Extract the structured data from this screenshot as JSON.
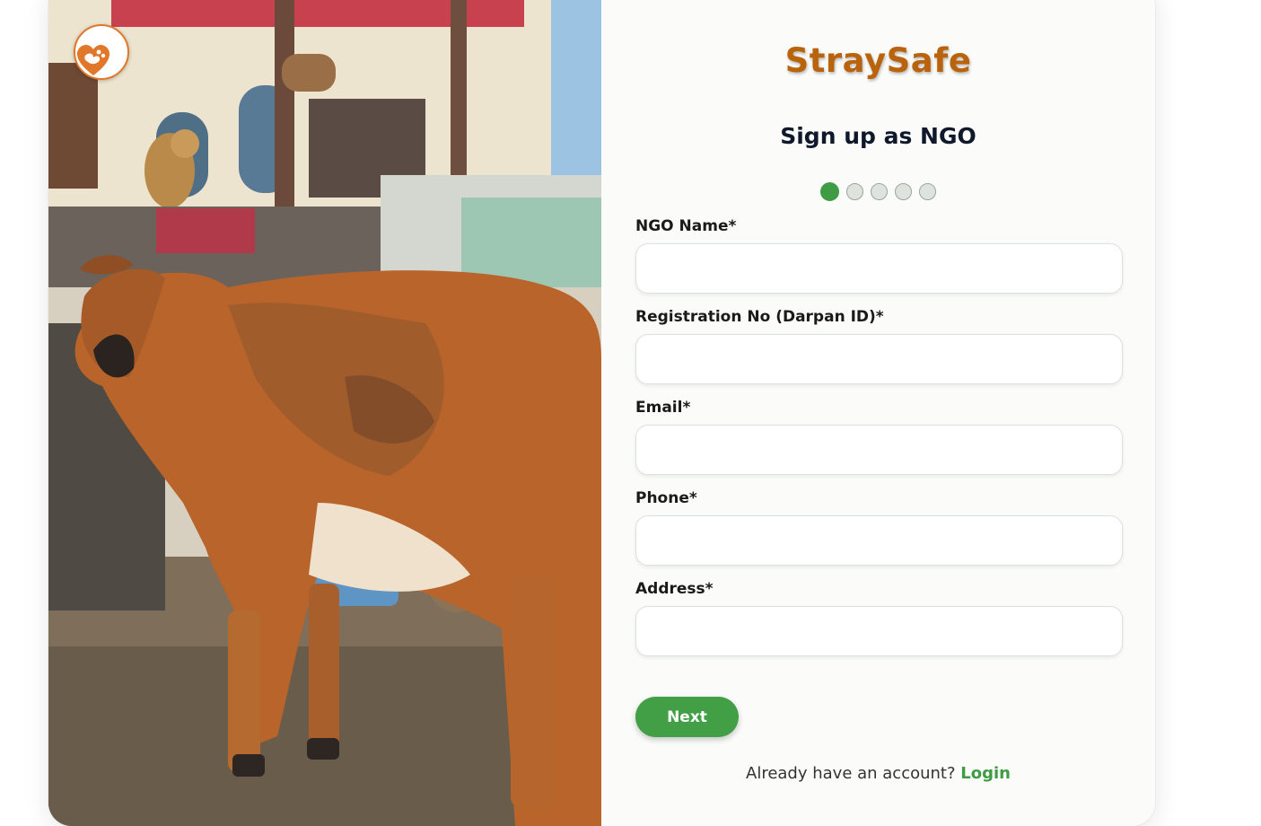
{
  "brand": {
    "name": "StraySafe"
  },
  "page": {
    "subtitle": "Sign up as NGO"
  },
  "stepper": {
    "total_steps": 5,
    "current_step": 1
  },
  "form": {
    "fields": [
      {
        "label": "NGO Name*",
        "value": "",
        "placeholder": ""
      },
      {
        "label": "Registration No (Darpan ID)*",
        "value": "",
        "placeholder": ""
      },
      {
        "label": "Email*",
        "value": "",
        "placeholder": ""
      },
      {
        "label": "Phone*",
        "value": "",
        "placeholder": ""
      },
      {
        "label": "Address*",
        "value": "",
        "placeholder": ""
      }
    ],
    "next_label": "Next"
  },
  "footer": {
    "prompt": "Already have an account?",
    "login_label": "Login"
  },
  "photo": {
    "icon": "heart-paw-logo-icon"
  },
  "colors": {
    "brand": "#b9640d",
    "accent_green": "#429f46",
    "heading": "#10192b",
    "logo_orange": "#e0772a"
  }
}
